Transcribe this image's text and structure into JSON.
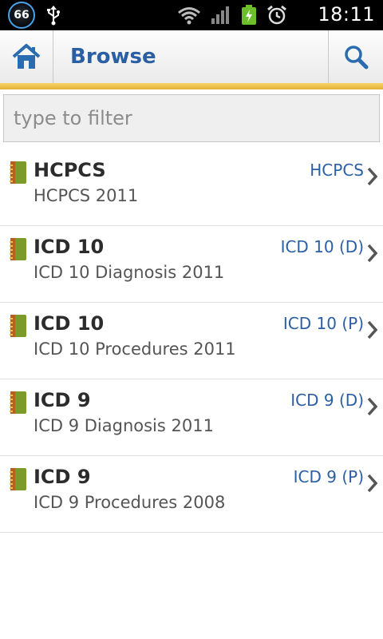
{
  "status_bar": {
    "badge_number": "66",
    "time": "18:11"
  },
  "action_bar": {
    "title": "Browse"
  },
  "filter": {
    "placeholder": "type to filter",
    "value": ""
  },
  "colors": {
    "accent_blue": "#2b5fa3",
    "accent_gold": "#e2b232"
  },
  "items": [
    {
      "name": "HCPCS",
      "description": "HCPCS 2011",
      "code": "HCPCS"
    },
    {
      "name": "ICD 10",
      "description": "ICD 10 Diagnosis 2011",
      "code": "ICD 10 (D)"
    },
    {
      "name": "ICD 10",
      "description": "ICD 10 Procedures 2011",
      "code": "ICD 10 (P)"
    },
    {
      "name": "ICD 9",
      "description": "ICD 9 Diagnosis 2011",
      "code": "ICD 9 (D)"
    },
    {
      "name": "ICD 9",
      "description": "ICD 9 Procedures 2008",
      "code": "ICD 9 (P)"
    }
  ]
}
